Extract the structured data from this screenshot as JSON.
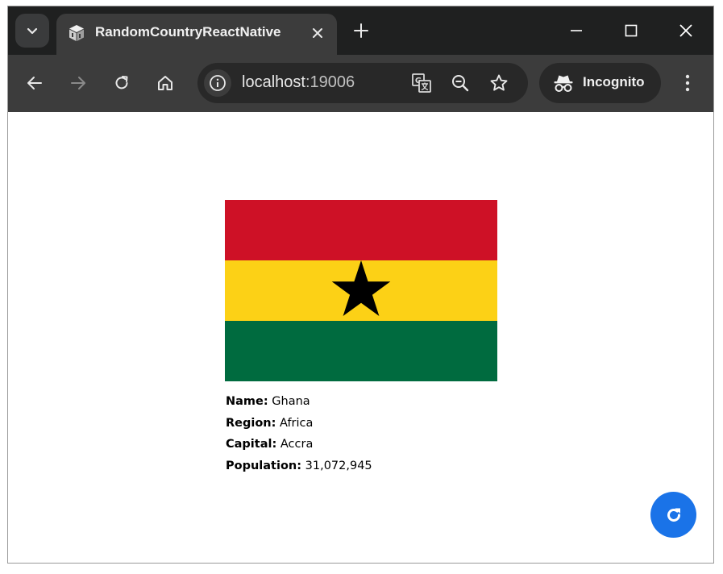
{
  "browser": {
    "tab_title": "RandomCountryReactNative",
    "url_host": "localhost",
    "url_port": ":19006",
    "incognito_label": "Incognito",
    "icons": [
      "tab-search-icon",
      "app-favicon-icon",
      "close-icon",
      "plus-icon",
      "minimize-icon",
      "maximize-icon",
      "close-window-icon",
      "back-arrow-icon",
      "forward-arrow-icon",
      "reload-icon",
      "home-icon",
      "info-icon",
      "translate-icon",
      "zoom-out-icon",
      "star-icon",
      "incognito-icon",
      "kebab-menu-icon"
    ]
  },
  "country": {
    "flag_colors": {
      "red": "#ce1126",
      "yellow": "#fcd116",
      "green": "#006b3f",
      "star": "#000000"
    },
    "fields": [
      {
        "label": "Name:",
        "value": "Ghana"
      },
      {
        "label": "Region:",
        "value": "Africa"
      },
      {
        "label": "Capital:",
        "value": "Accra"
      },
      {
        "label": "Population:",
        "value": "31,072,945"
      }
    ]
  },
  "fab": {
    "icon": "refresh-icon",
    "color": "#1a73e8"
  }
}
